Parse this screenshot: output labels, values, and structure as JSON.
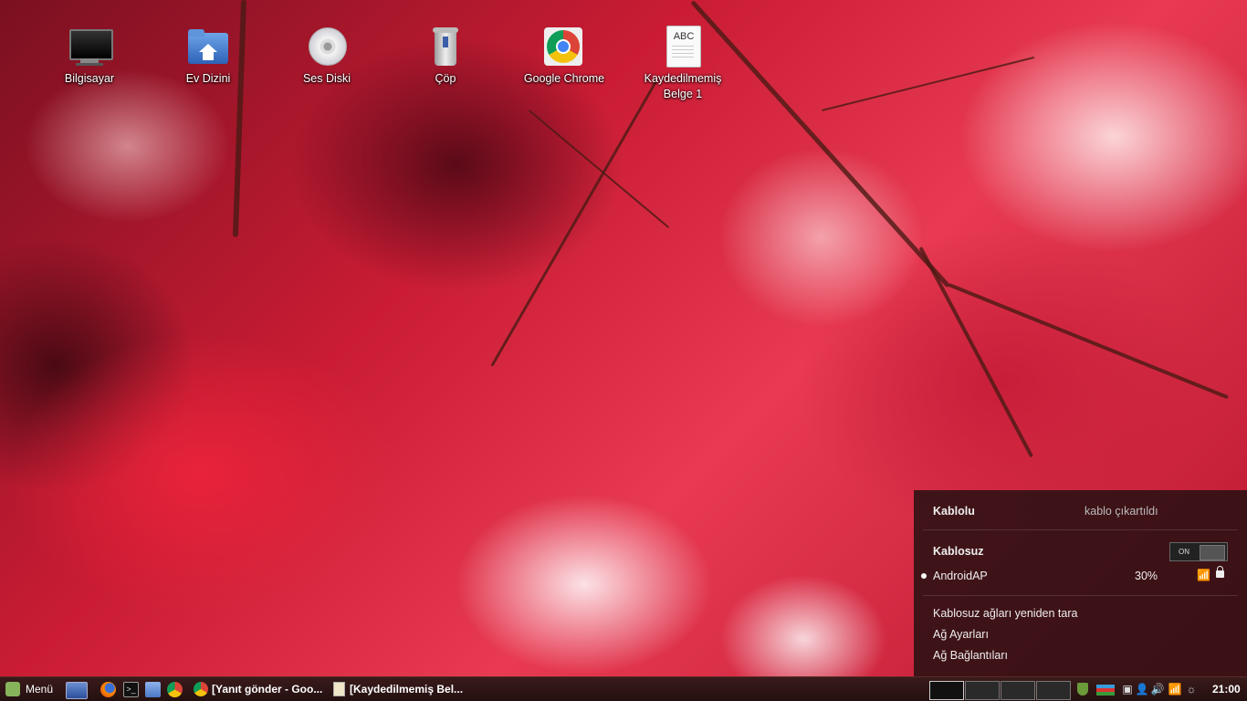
{
  "desktop": {
    "icons": [
      {
        "label": "Bilgisayar",
        "icon": "computer-icon"
      },
      {
        "label": "Ev Dizini",
        "icon": "home-folder-icon"
      },
      {
        "label": "Ses Diski",
        "icon": "audio-disc-icon"
      },
      {
        "label": "Çöp",
        "icon": "trash-icon"
      },
      {
        "label": "Google Chrome",
        "icon": "chrome-icon"
      },
      {
        "label": "Kaydedilmemiş Belge 1",
        "icon": "text-document-icon",
        "icon_text": "ABC"
      }
    ]
  },
  "network_menu": {
    "wired_label": "Kablolu",
    "wired_status": "kablo çıkartıldı",
    "wireless_label": "Kablosuz",
    "wireless_toggle": "ON",
    "networks": [
      {
        "name": "AndroidAP",
        "signal": "30%",
        "connected": true
      }
    ],
    "actions": [
      "Kablosuz ağları yeniden tara",
      "Ağ Ayarları",
      "Ağ Bağlantıları"
    ]
  },
  "taskbar": {
    "menu_label": "Menü",
    "windows": [
      {
        "label": "[Yanıt gönder - Goo...",
        "icon": "chrome-icon"
      },
      {
        "label": "[Kaydedilmemiş Bel...",
        "icon": "text-editor-icon"
      }
    ],
    "workspaces": 4,
    "active_workspace": 1,
    "clock": "21:00"
  },
  "colors": {
    "accent": "#87b35b",
    "popup_bg": "#261012",
    "taskbar_bg": "#2a1212"
  }
}
